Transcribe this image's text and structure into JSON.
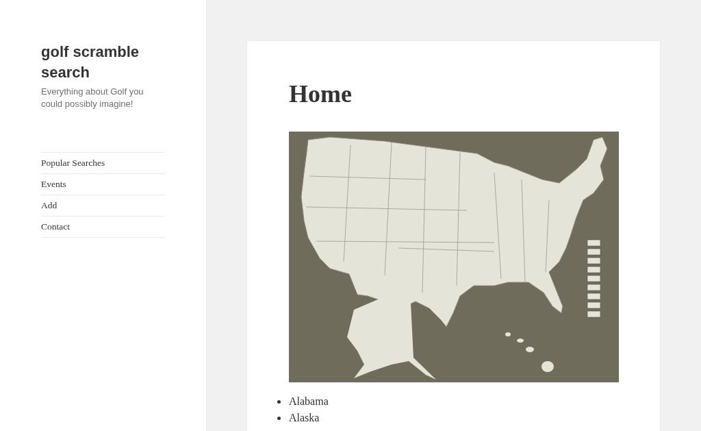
{
  "site": {
    "title": "golf scramble search",
    "description": "Everything about Golf you could possibly imagine!"
  },
  "menu": [
    {
      "label": "Popular Searches"
    },
    {
      "label": "Events"
    },
    {
      "label": "Add"
    },
    {
      "label": "Contact"
    }
  ],
  "page": {
    "title": "Home",
    "states": [
      "Alabama",
      "Alaska"
    ]
  }
}
